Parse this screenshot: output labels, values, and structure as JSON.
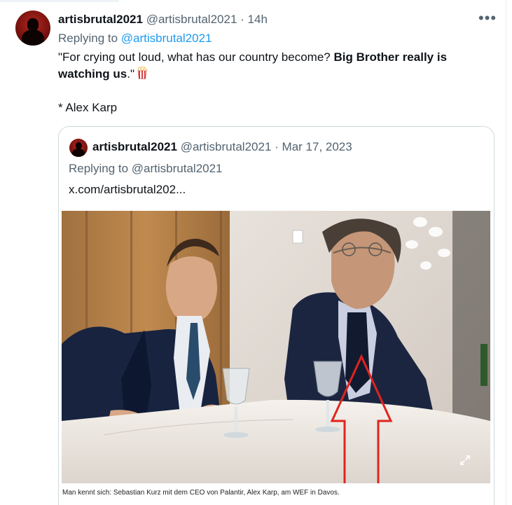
{
  "tweet": {
    "author_name": "artisbrutal2021",
    "author_handle": "@artisbrutal2021",
    "separator": "·",
    "time": "14h",
    "more_label": "•••",
    "replying_prefix": "Replying to",
    "replying_handle": "@artisbrutal2021",
    "text_part1": "\"For crying out loud, what has our country become? ",
    "text_bold": "Big Brother really is watching us",
    "text_part2": ".\"",
    "emoji_icon": "popcorn-icon",
    "signature": "* Alex Karp"
  },
  "quoted": {
    "author_name": "artisbrutal2021",
    "author_handle": "@artisbrutal2021",
    "separator": "·",
    "date": "Mar 17, 2023",
    "replying_prefix": "Replying to",
    "replying_handle": "@artisbrutal2021",
    "link_text": "x.com/artisbrutal202...",
    "image_caption": "Man kennt sich: Sebastian Kurz mit dem CEO von Palantir, Alex Karp, am WEF in Davos."
  },
  "colors": {
    "link": "#1d9bf0",
    "muted": "#536471",
    "annotation_arrow": "#e0241f"
  }
}
